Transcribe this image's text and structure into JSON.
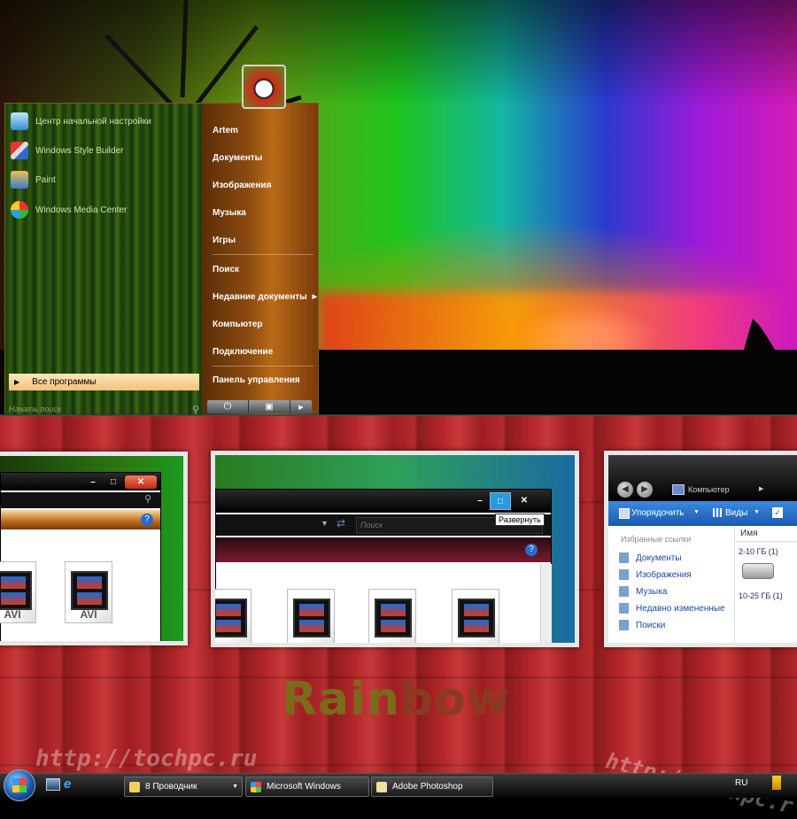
{
  "start_menu": {
    "pinned": [
      {
        "label": "Центр начальной настройки",
        "icon": "welcome-center-icon"
      },
      {
        "label": "Windows Style Builder",
        "icon": "style-builder-icon"
      },
      {
        "label": "Paint",
        "icon": "paint-icon"
      },
      {
        "label": "Windows Media Center",
        "icon": "media-center-icon"
      }
    ],
    "all_programs": "Все программы",
    "search_placeholder": "Начать поиск",
    "right_items": [
      "Artem",
      "Документы",
      "Изображения",
      "Музыка",
      "Игры",
      "Поиск",
      "Недавние документы",
      "Компьютер",
      "Подключение",
      "Панель управления"
    ]
  },
  "thumb2": {
    "search_placeholder": "Поиск",
    "tooltip": "Развернуть"
  },
  "thumb1": {
    "file_labels": [
      "AVI",
      "AVI"
    ]
  },
  "thumb3": {
    "address": "Компьютер",
    "organize": "Упорядочить",
    "views": "Виды",
    "favorites_header": "Избранные ссылки",
    "favorites": [
      "Документы",
      "Изображения",
      "Музыка",
      "Недавно измененные",
      "Поиски"
    ],
    "column_name": "Имя",
    "groups": [
      "2-10 ГБ (1)",
      "10-25 ГБ (1)"
    ]
  },
  "brand": {
    "part1": "Rain",
    "part2": "bow"
  },
  "watermarks": {
    "left": "http://tochpc.ru",
    "right": "http://Tochpc.r"
  },
  "taskbar": {
    "tasks": [
      "8 Проводник",
      "Microsoft Windows",
      "Adobe Photoshop"
    ],
    "language": "RU"
  }
}
